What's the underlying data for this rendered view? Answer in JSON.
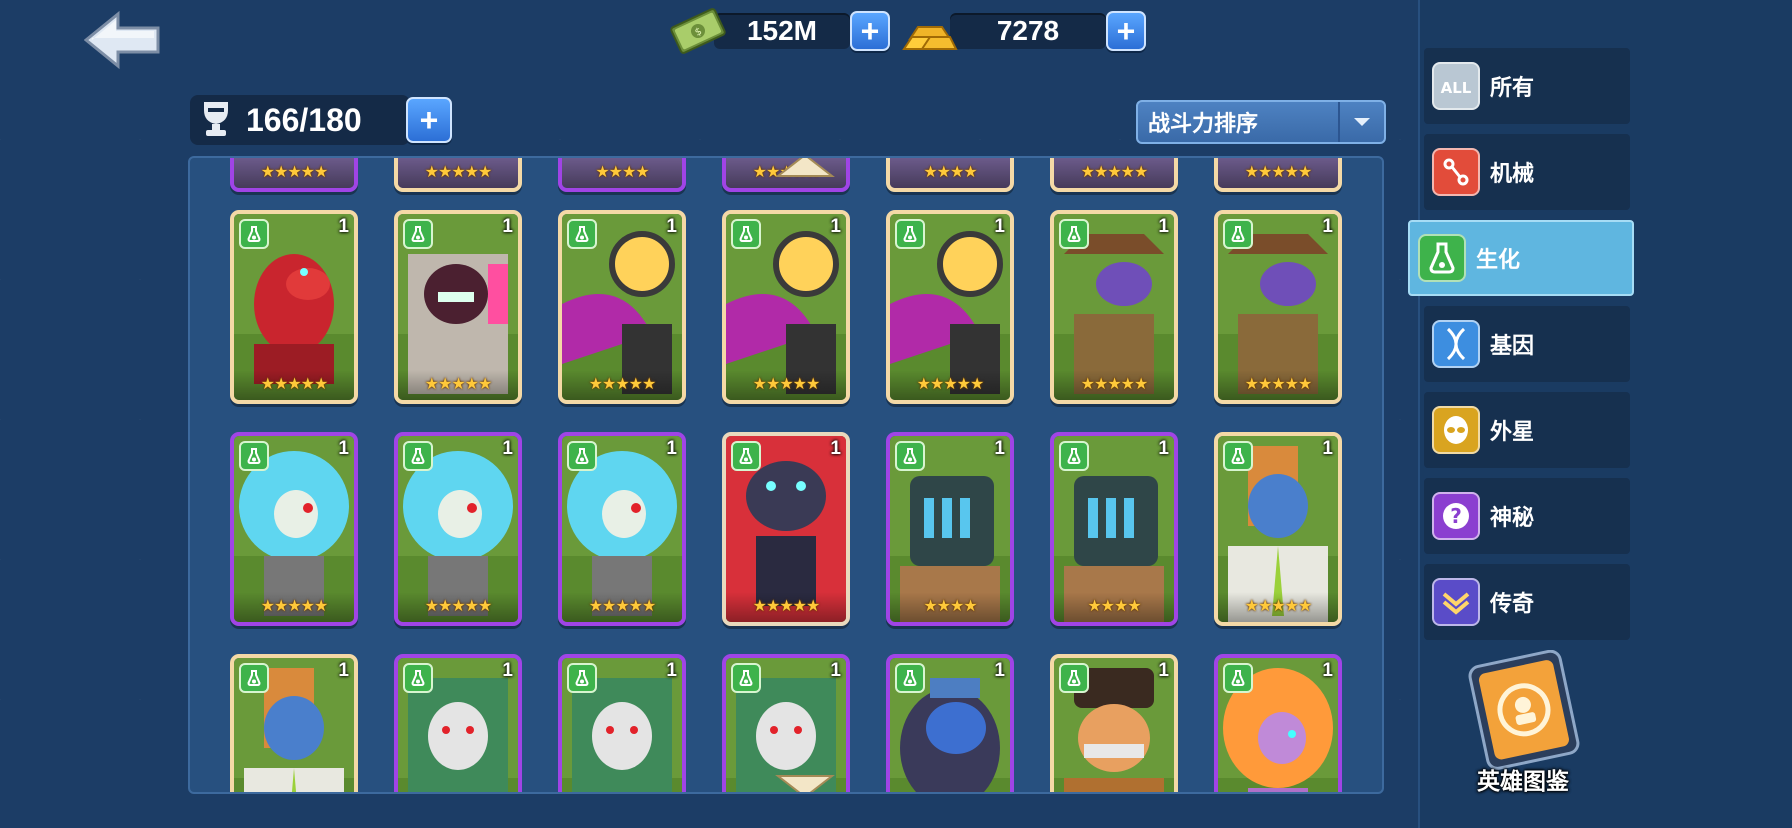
{
  "currency": {
    "cash": {
      "value": "152M",
      "icon": "cash-icon"
    },
    "gold": {
      "value": "7278",
      "icon": "gold-bar-icon"
    }
  },
  "capacity": {
    "text": "166/180",
    "icon": "trophy-icon"
  },
  "sort": {
    "selected": "战斗力排序"
  },
  "categories": [
    {
      "label": "所有",
      "icon": "all-icon",
      "badge": "ALL"
    },
    {
      "label": "机械",
      "icon": "mech-icon"
    },
    {
      "label": "生化",
      "icon": "biochem-flask-icon"
    },
    {
      "label": "基因",
      "icon": "gene-dna-icon"
    },
    {
      "label": "外星",
      "icon": "alien-icon"
    },
    {
      "label": "神秘",
      "icon": "mystery-icon"
    },
    {
      "label": "传奇",
      "icon": "legend-icon"
    }
  ],
  "active_category": "生化",
  "codex": {
    "label": "英雄图鉴",
    "icon": "codex-book-icon"
  },
  "heroes_top_partial": [
    {
      "stars": "★★★★★",
      "frame": "purple"
    },
    {
      "stars": "★★★★★",
      "frame": "gold"
    },
    {
      "stars": "★★★★",
      "frame": "purple"
    },
    {
      "stars": "★★★★★",
      "frame": "purple"
    },
    {
      "stars": "★★★★",
      "frame": "gold"
    },
    {
      "stars": "★★★★★",
      "frame": "gold"
    },
    {
      "stars": "★★★★★",
      "frame": "gold"
    }
  ],
  "heroes": [
    {
      "level": "1",
      "stars": "★★★★★",
      "frame": "gold",
      "art": "red-bear"
    },
    {
      "level": "1",
      "stars": "★★★★★",
      "frame": "gold",
      "art": "purple-ape"
    },
    {
      "level": "1",
      "stars": "★★★★★",
      "frame": "gold",
      "art": "shark-diver"
    },
    {
      "level": "1",
      "stars": "★★★★★",
      "frame": "gold",
      "art": "shark-diver"
    },
    {
      "level": "1",
      "stars": "★★★★★",
      "frame": "gold",
      "art": "shark-diver"
    },
    {
      "level": "1",
      "stars": "★★★★★",
      "frame": "gold",
      "art": "cowboy-lizard"
    },
    {
      "level": "1",
      "stars": "★★★★★",
      "frame": "gold",
      "art": "cowboy-lizard"
    },
    {
      "level": "1",
      "stars": "★★★★★",
      "frame": "purple",
      "art": "blue-hair-girl"
    },
    {
      "level": "1",
      "stars": "★★★★★",
      "frame": "purple",
      "art": "blue-hair-girl"
    },
    {
      "level": "1",
      "stars": "★★★★★",
      "frame": "purple",
      "art": "blue-hair-girl"
    },
    {
      "level": "1",
      "stars": "★★★★★",
      "frame": "gray",
      "art": "robot-gorilla"
    },
    {
      "level": "1",
      "stars": "★★★★",
      "frame": "purple",
      "art": "cage-head"
    },
    {
      "level": "1",
      "stars": "★★★★",
      "frame": "purple",
      "art": "cage-head"
    },
    {
      "level": "1",
      "stars": "★★★★★",
      "frame": "gold",
      "art": "blue-scientist"
    },
    {
      "level": "1",
      "stars": "",
      "frame": "gold",
      "art": "blue-scientist"
    },
    {
      "level": "1",
      "stars": "",
      "frame": "purple",
      "art": "hockey-zombie"
    },
    {
      "level": "1",
      "stars": "",
      "frame": "purple",
      "art": "hockey-zombie"
    },
    {
      "level": "1",
      "stars": "",
      "frame": "purple",
      "art": "hockey-zombie"
    },
    {
      "level": "1",
      "stars": "",
      "frame": "purple",
      "art": "blue-gorilla"
    },
    {
      "level": "1",
      "stars": "",
      "frame": "gold",
      "art": "fireman"
    },
    {
      "level": "1",
      "stars": "",
      "frame": "purple",
      "art": "orange-hair-girl"
    }
  ],
  "colors": {
    "background": "#1c3d66",
    "panel": "#27507f",
    "active_category": "#5fb6e0",
    "plus_button": "#2c6fd6",
    "biochem_badge": "#3eb34b",
    "star": "#ffc93a"
  }
}
